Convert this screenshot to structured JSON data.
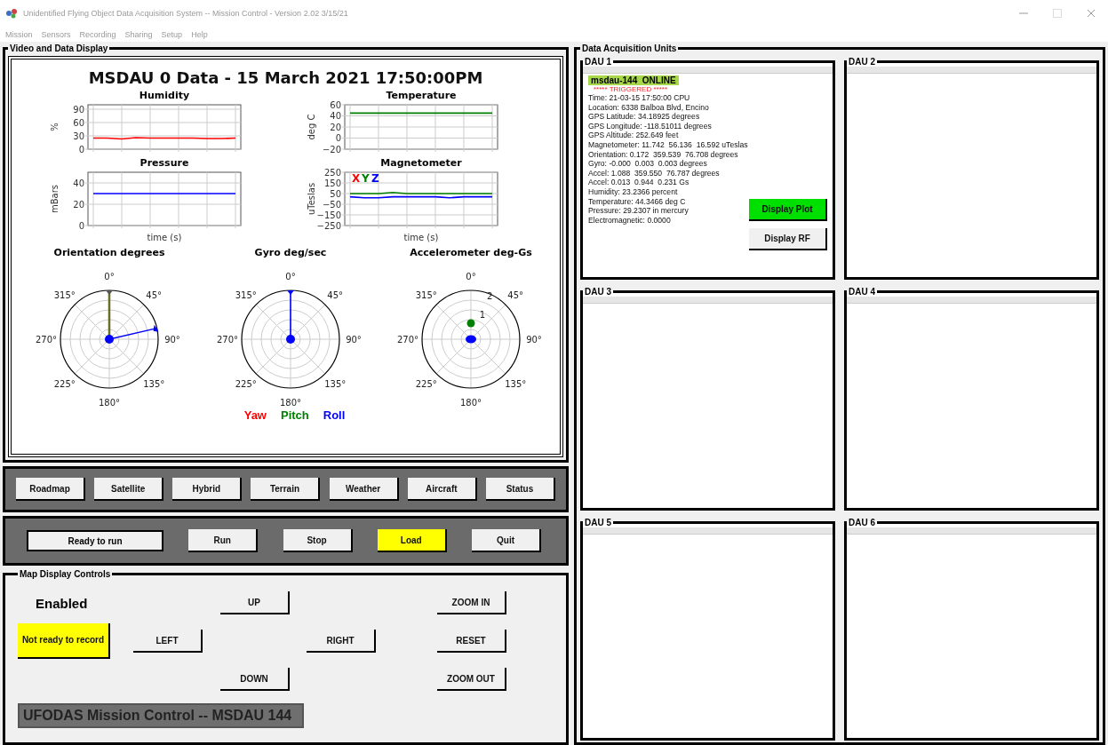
{
  "window": {
    "title": "Unidentified Flying Object Data Acquisition System -- Mission Control - Version 2.02 3/15/21"
  },
  "menu": [
    "Mission",
    "Sensors",
    "Recording",
    "Sharing",
    "Setup",
    "Help"
  ],
  "video_panel": {
    "label": "Video and Data Display",
    "heading": "MSDAU 0 Data - 15 March 2021 17:50:00PM",
    "charts": [
      {
        "chart_data": {
          "type": "line",
          "title": "Humidity",
          "ylabel": "%",
          "grid": true,
          "ylim": [
            0,
            100
          ],
          "yticks": [
            0,
            30,
            60,
            90
          ],
          "series": [
            {
              "color": "#ff0000",
              "values": [
                25,
                25,
                23,
                26,
                25,
                25,
                25,
                25,
                24,
                24,
                25
              ]
            }
          ]
        }
      },
      {
        "chart_data": {
          "type": "line",
          "title": "Temperature",
          "ylabel": "deg C",
          "grid": true,
          "ylim": [
            -20,
            60
          ],
          "yticks": [
            -20,
            0,
            20,
            40,
            60
          ],
          "series": [
            {
              "color": "#008000",
              "values": [
                45,
                45,
                45,
                45,
                45,
                45,
                45,
                45,
                45,
                45,
                45
              ]
            }
          ]
        }
      },
      {
        "chart_data": {
          "type": "line",
          "title": "Pressure",
          "xlabel": "time (s)",
          "ylabel": "mBars",
          "grid": true,
          "ylim": [
            0,
            50
          ],
          "yticks": [
            0,
            20,
            40
          ],
          "series": [
            {
              "color": "#0000ff",
              "values": [
                30,
                30,
                30,
                30,
                30,
                30,
                30,
                30,
                30,
                30,
                30
              ]
            }
          ]
        }
      },
      {
        "chart_data": {
          "type": "line",
          "title": "Magnetometer",
          "xlabel": "time (s)",
          "ylabel": "uTeslas",
          "grid": true,
          "ylim": [
            -250,
            250
          ],
          "yticks": [
            -250,
            -150,
            -50,
            50,
            150,
            250
          ],
          "series": [
            {
              "name": "X",
              "color": "#ff0000",
              "values": [
                null,
                null,
                null,
                null,
                null,
                null,
                null,
                null,
                null,
                null,
                null
              ]
            },
            {
              "name": "Y",
              "color": "#008000",
              "values": [
                50,
                50,
                50,
                60,
                50,
                50,
                50,
                50,
                50,
                50,
                50
              ]
            },
            {
              "name": "Z",
              "color": "#0000ff",
              "values": [
                20,
                10,
                10,
                20,
                20,
                20,
                20,
                10,
                20,
                20,
                20
              ]
            }
          ]
        }
      }
    ],
    "polar_plots": [
      {
        "kind": "orientation",
        "title": "Orientation degrees",
        "angle_labels": [
          "0°",
          "45°",
          "90°",
          "135°",
          "180°",
          "225°",
          "270°",
          "315°"
        ]
      },
      {
        "kind": "gyro",
        "title": "Gyro deg/sec",
        "angle_labels": [
          "0°",
          "45°",
          "90°",
          "135°",
          "180°",
          "225°",
          "270°",
          "315°"
        ]
      },
      {
        "kind": "accel",
        "title": "Accelerometer deg-Gs",
        "angle_labels": [
          "0°",
          "45°",
          "90°",
          "135°",
          "180°",
          "225°",
          "270°",
          "315°"
        ],
        "ring_labels": [
          "1",
          "2"
        ]
      }
    ],
    "legend": [
      {
        "label": "Yaw",
        "color": "#ff0000"
      },
      {
        "label": "Pitch",
        "color": "#008000"
      },
      {
        "label": "Roll",
        "color": "#0000ff"
      }
    ]
  },
  "map_type_buttons": [
    "Roadmap",
    "Satellite",
    "Hybrid",
    "Terrain",
    "Weather",
    "Aircraft",
    "Status"
  ],
  "run_bar": {
    "status": "Ready to run",
    "buttons": [
      {
        "label": "Run",
        "highlighted": false
      },
      {
        "label": "Stop",
        "highlighted": false
      },
      {
        "label": "Load",
        "highlighted": true
      },
      {
        "label": "Quit",
        "highlighted": false
      }
    ]
  },
  "map_controls": {
    "label": "Map Display Controls",
    "state": "Enabled",
    "record_button": "Not ready to record",
    "up": "UP",
    "left": "LEFT",
    "right": "RIGHT",
    "down": "DOWN",
    "zoom_in": "ZOOM IN",
    "reset": "RESET",
    "zoom_out": "ZOOM OUT",
    "status_bar": "UFODAS Mission Control -- MSDAU 144"
  },
  "dau_panel": {
    "label": "Data Acquisition Units",
    "units": [
      {
        "label": "DAU 1",
        "header": "msdau-144  ONLINE",
        "alert": "***** TRIGGERED *****",
        "lines": [
          "Time: 21-03-15 17:50:00 CPU",
          "Location: 6338 Balboa Blvd, Encino",
          "GPS Latitude: 34.18925 degrees",
          "GPS Longitude: -118.51011 degrees",
          "GPS Altitude: 252.649 feet",
          "Magnetometer: 11.742  56.136  16.592 uTeslas",
          "Orientation: 0.172  359.539  76.708 degrees",
          "Gyro: -0.000  0.003  0.003 degrees",
          "Accel: 1.088  359.550  76.787 degrees",
          "Accel: 0.013  0.944  0.231 Gs",
          "Humidity: 23.2366 percent",
          "Temperature: 44.3466 deg C",
          "Pressure: 29.2307 in mercury",
          "Electromagnetic: 0.0000"
        ],
        "buttons": [
          {
            "label": "Display Plot",
            "highlighted": true
          },
          {
            "label": "Display RF",
            "highlighted": false
          }
        ]
      },
      {
        "label": "DAU 2"
      },
      {
        "label": "DAU 3"
      },
      {
        "label": "DAU 4"
      },
      {
        "label": "DAU 5"
      },
      {
        "label": "DAU 6"
      }
    ]
  }
}
